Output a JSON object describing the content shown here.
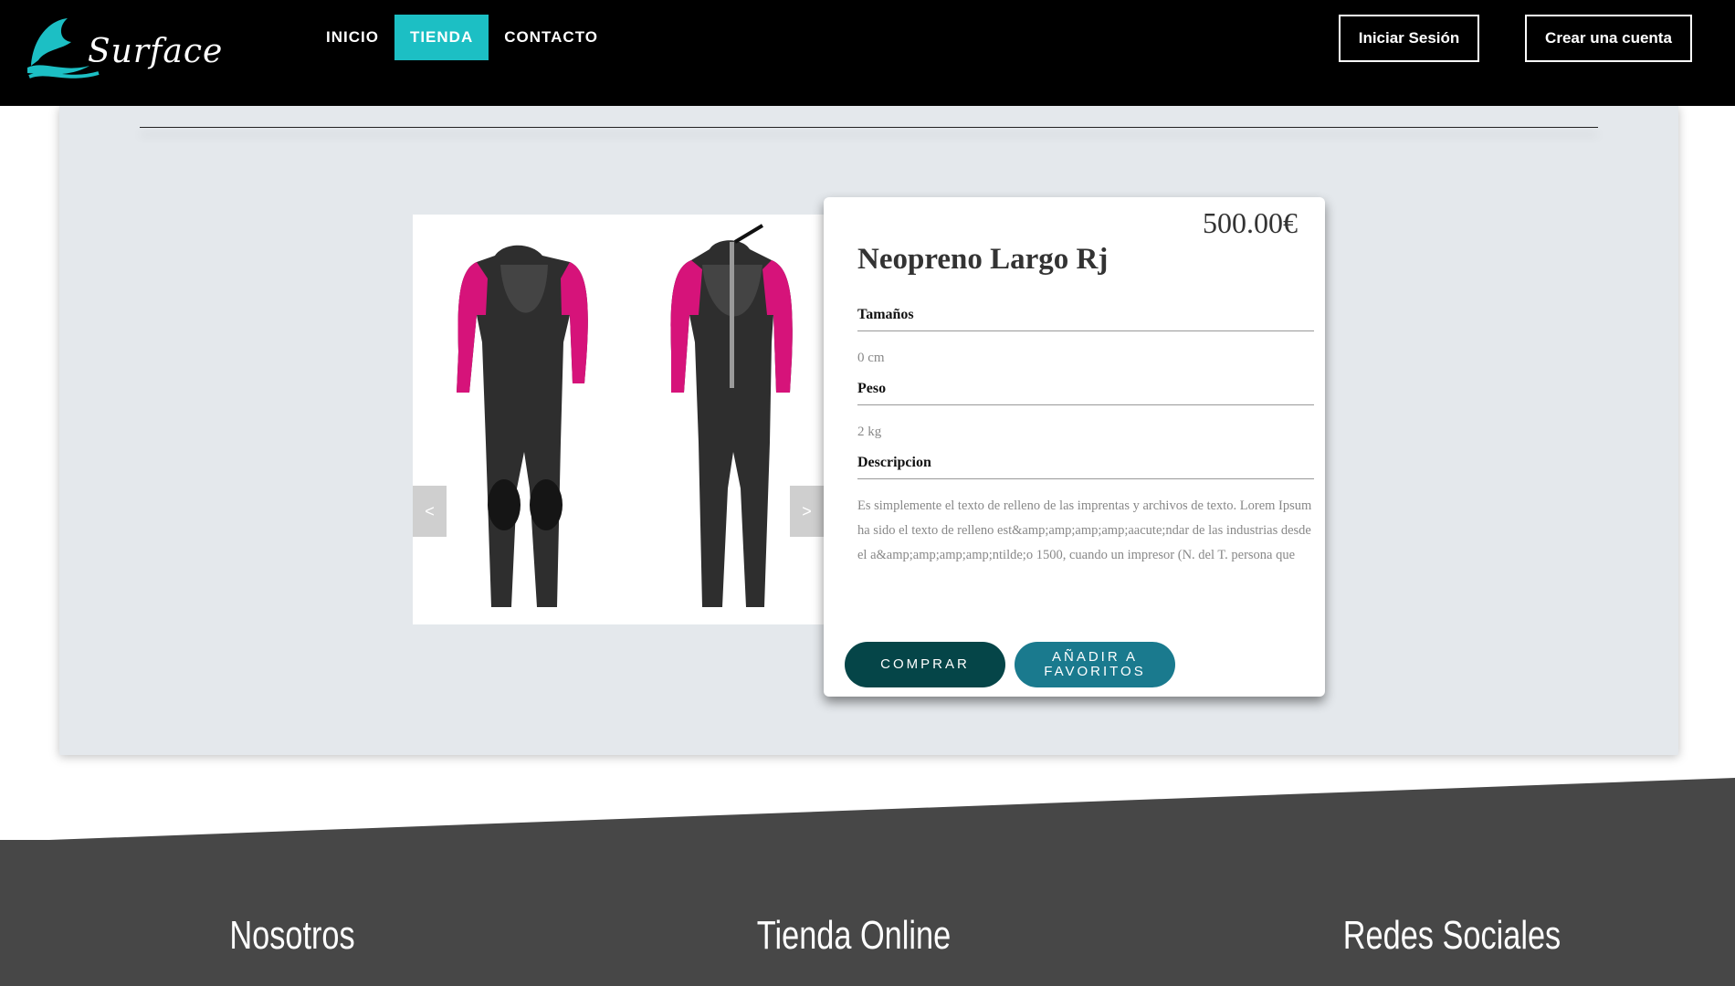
{
  "header": {
    "brand": "Surface",
    "nav": [
      {
        "label": "INICIO"
      },
      {
        "label": "TIENDA",
        "active": true
      },
      {
        "label": "CONTACTO"
      }
    ],
    "login_label": "Iniciar Sesión",
    "register_label": "Crear una cuenta",
    "accent_color": "#1cbfc4"
  },
  "product": {
    "price": "500.00€",
    "name": "Neopreno Largo Rj",
    "sizes_label": "Tamaños",
    "sizes_value": "0 cm",
    "weight_label": "Peso",
    "weight_value": "2 kg",
    "description_label": "Descripcion",
    "description_value": "Es simplemente el texto de relleno de las imprentas y archivos de texto. Lorem Ipsum ha sido el texto de relleno est&amp;amp;amp;amp;aacute;ndar de las industrias desde el a&amp;amp;amp;amp;ntilde;o 1500, cuando un impresor (N. del T. persona que",
    "buy_label": "COMPRAR",
    "favorite_label": "AÑADIR A FAVORITOS",
    "carousel_prev": "<",
    "carousel_next": ">"
  },
  "footer": {
    "col1": "Nosotros",
    "col2": "Tienda Online",
    "col3": "Redes Sociales"
  }
}
